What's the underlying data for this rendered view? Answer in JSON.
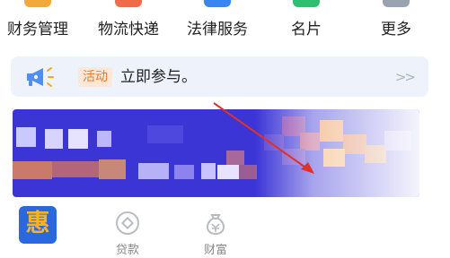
{
  "top_grid": [
    {
      "label": "财务管理",
      "icon": "finance-icon"
    },
    {
      "label": "物流快递",
      "icon": "delivery-icon"
    },
    {
      "label": "法律服务",
      "icon": "law-icon"
    },
    {
      "label": "名片",
      "icon": "card-icon"
    },
    {
      "label": "更多",
      "icon": "more-icon"
    }
  ],
  "banner": {
    "tag": "活动",
    "text": "立即参与。",
    "more": ">>",
    "colors": {
      "background": "#eef3fb",
      "tag_bg": "#fde7d6",
      "tag_text": "#f07a2a"
    }
  },
  "promo": {
    "state": "pixelated",
    "color": "#3b35d6"
  },
  "bottom_nav": [
    {
      "glyph": "惠",
      "label": "",
      "icon": "hui-icon"
    },
    {
      "label": "贷款",
      "icon": "loan-icon"
    },
    {
      "label": "财富",
      "icon": "wealth-icon"
    }
  ],
  "annotation": {
    "type": "red-arrow"
  }
}
